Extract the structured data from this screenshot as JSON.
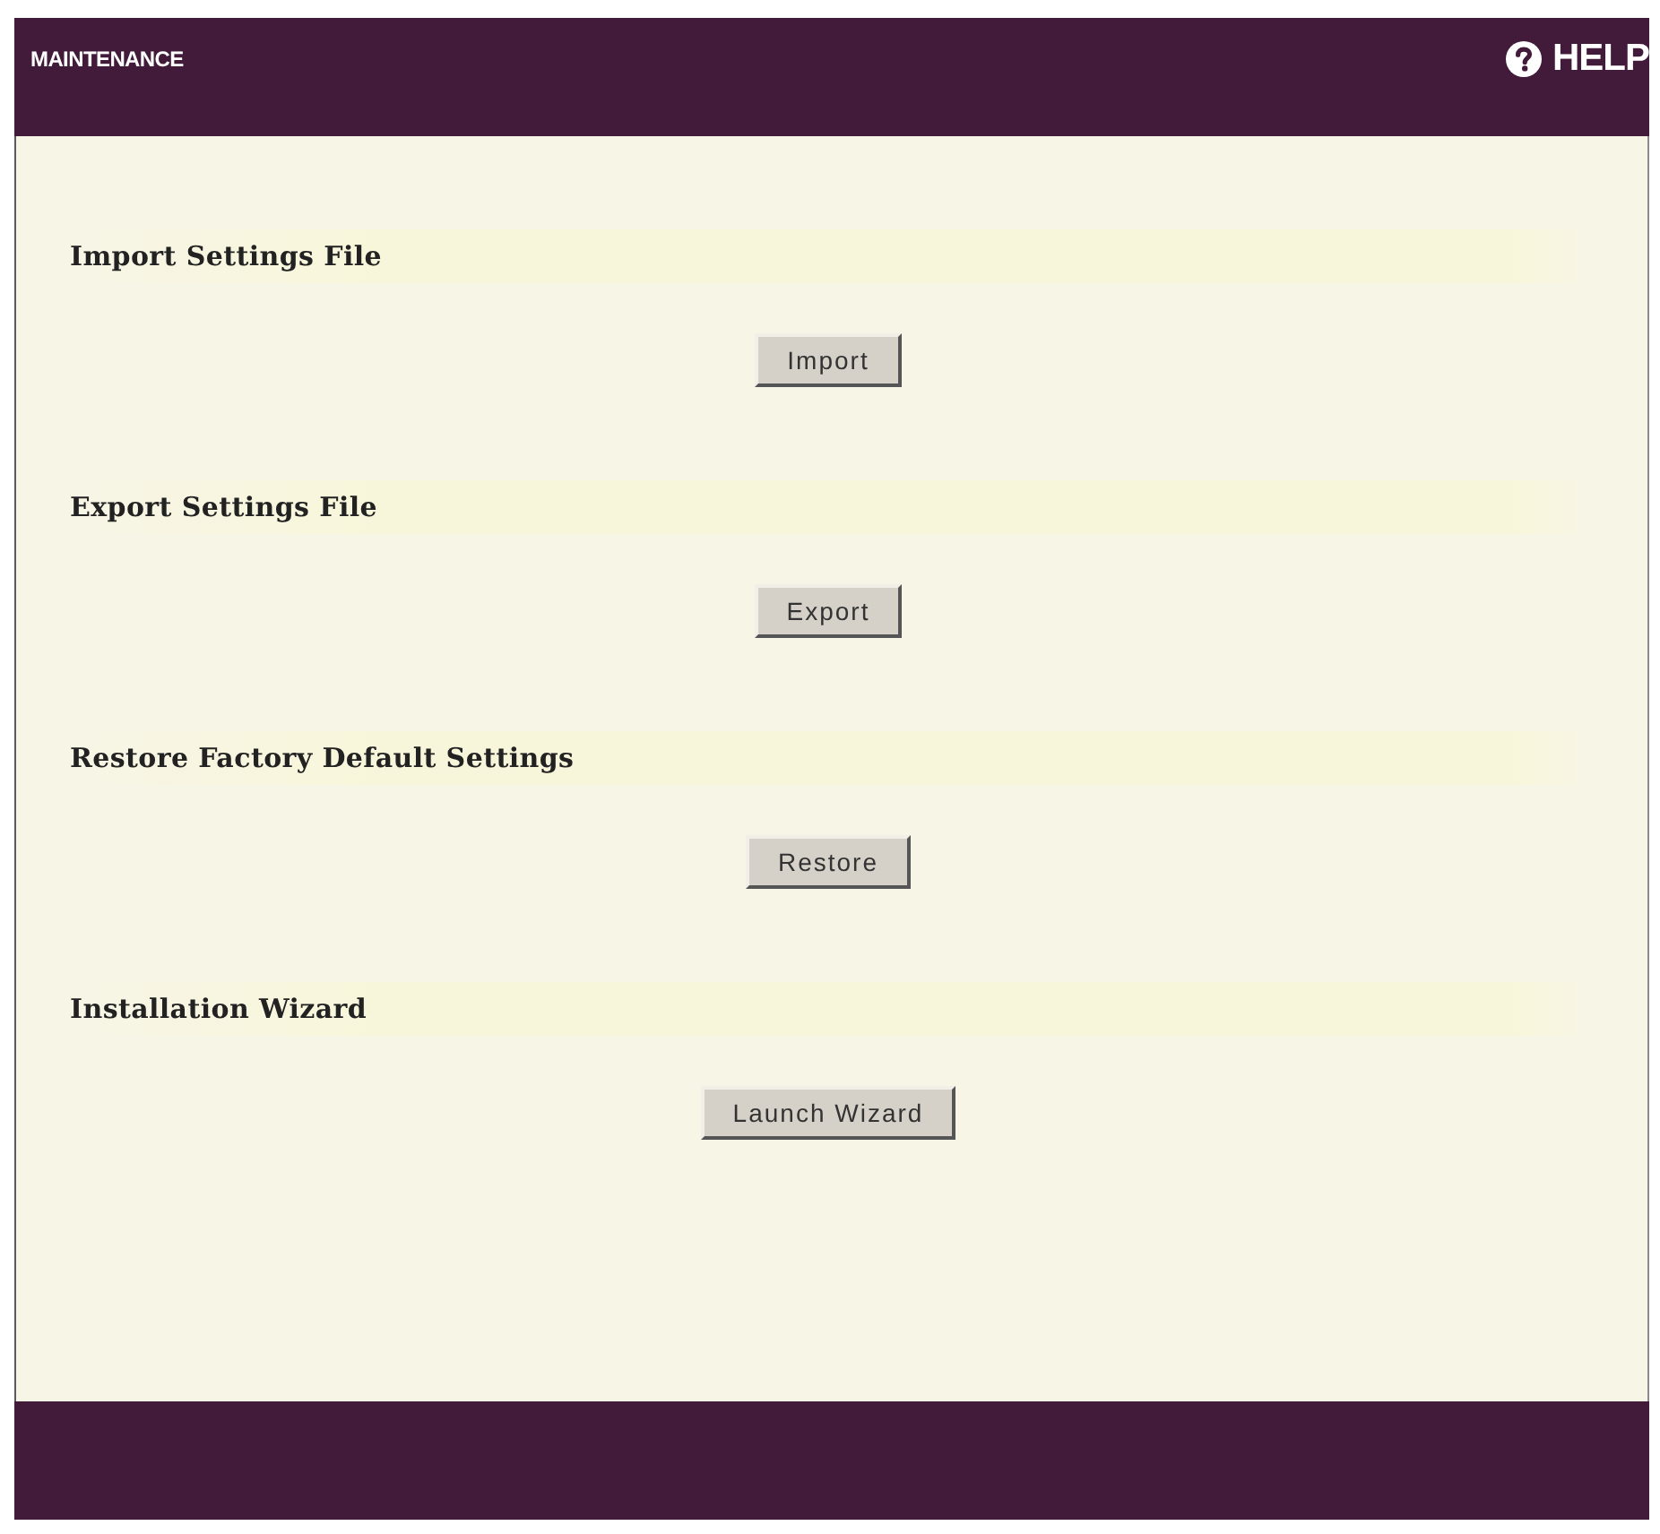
{
  "header": {
    "title": "MAINTENANCE",
    "help": "HELP"
  },
  "sections": [
    {
      "title": "Import Settings File",
      "button": "Import"
    },
    {
      "title": "Export Settings File",
      "button": "Export"
    },
    {
      "title": "Restore Factory Default Settings",
      "button": "Restore"
    },
    {
      "title": "Installation Wizard",
      "button": "Launch Wizard"
    }
  ]
}
